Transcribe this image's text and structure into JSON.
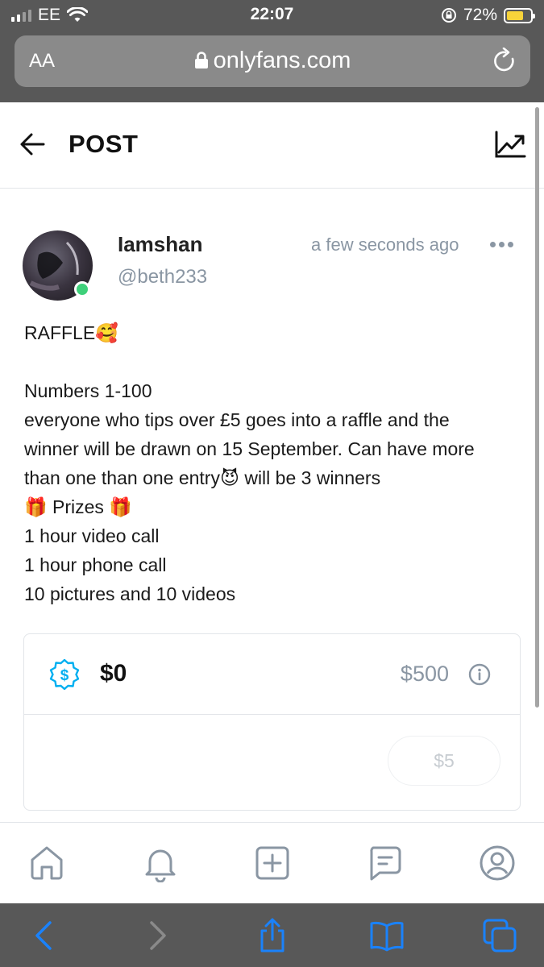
{
  "status_bar": {
    "carrier": "EE",
    "time": "22:07",
    "battery": "72%",
    "battery_level": 0.72
  },
  "browser": {
    "text_size_label": "AA",
    "url": "onlyfans.com"
  },
  "header": {
    "title": "POST"
  },
  "post": {
    "author_name": "Iamshan",
    "author_handle": "@beth233",
    "timestamp": "a few seconds ago",
    "body_lines": [
      "RAFFLE🥰",
      "",
      "Numbers 1-100",
      "everyone who tips over £5 goes into a raffle and the",
      "winner will be drawn on 15 September. Can have more",
      "than one than one entry😈 will be 3 winners",
      "🎁 Prizes 🎁",
      "1 hour video call",
      "1 hour phone call",
      "10 pictures and 10 videos"
    ]
  },
  "tip_goal": {
    "current": "$0",
    "goal": "$500",
    "tip_button": "$5"
  },
  "colors": {
    "accent": "#00aff0",
    "muted_text": "#8a96a3",
    "online": "#3ed07a",
    "browser_chrome": "#585858",
    "safari_blue": "#1a82fb"
  },
  "icons": {
    "back": "arrow-left-icon",
    "stats": "trending-up-icon",
    "more": "more-horizontal-icon",
    "tip": "dollar-badge-icon",
    "info": "info-icon",
    "nav": [
      "home-icon",
      "bell-icon",
      "plus-square-icon",
      "message-icon",
      "profile-icon"
    ],
    "safari": [
      "back-icon",
      "forward-icon",
      "share-icon",
      "bookmarks-icon",
      "tabs-icon"
    ]
  }
}
